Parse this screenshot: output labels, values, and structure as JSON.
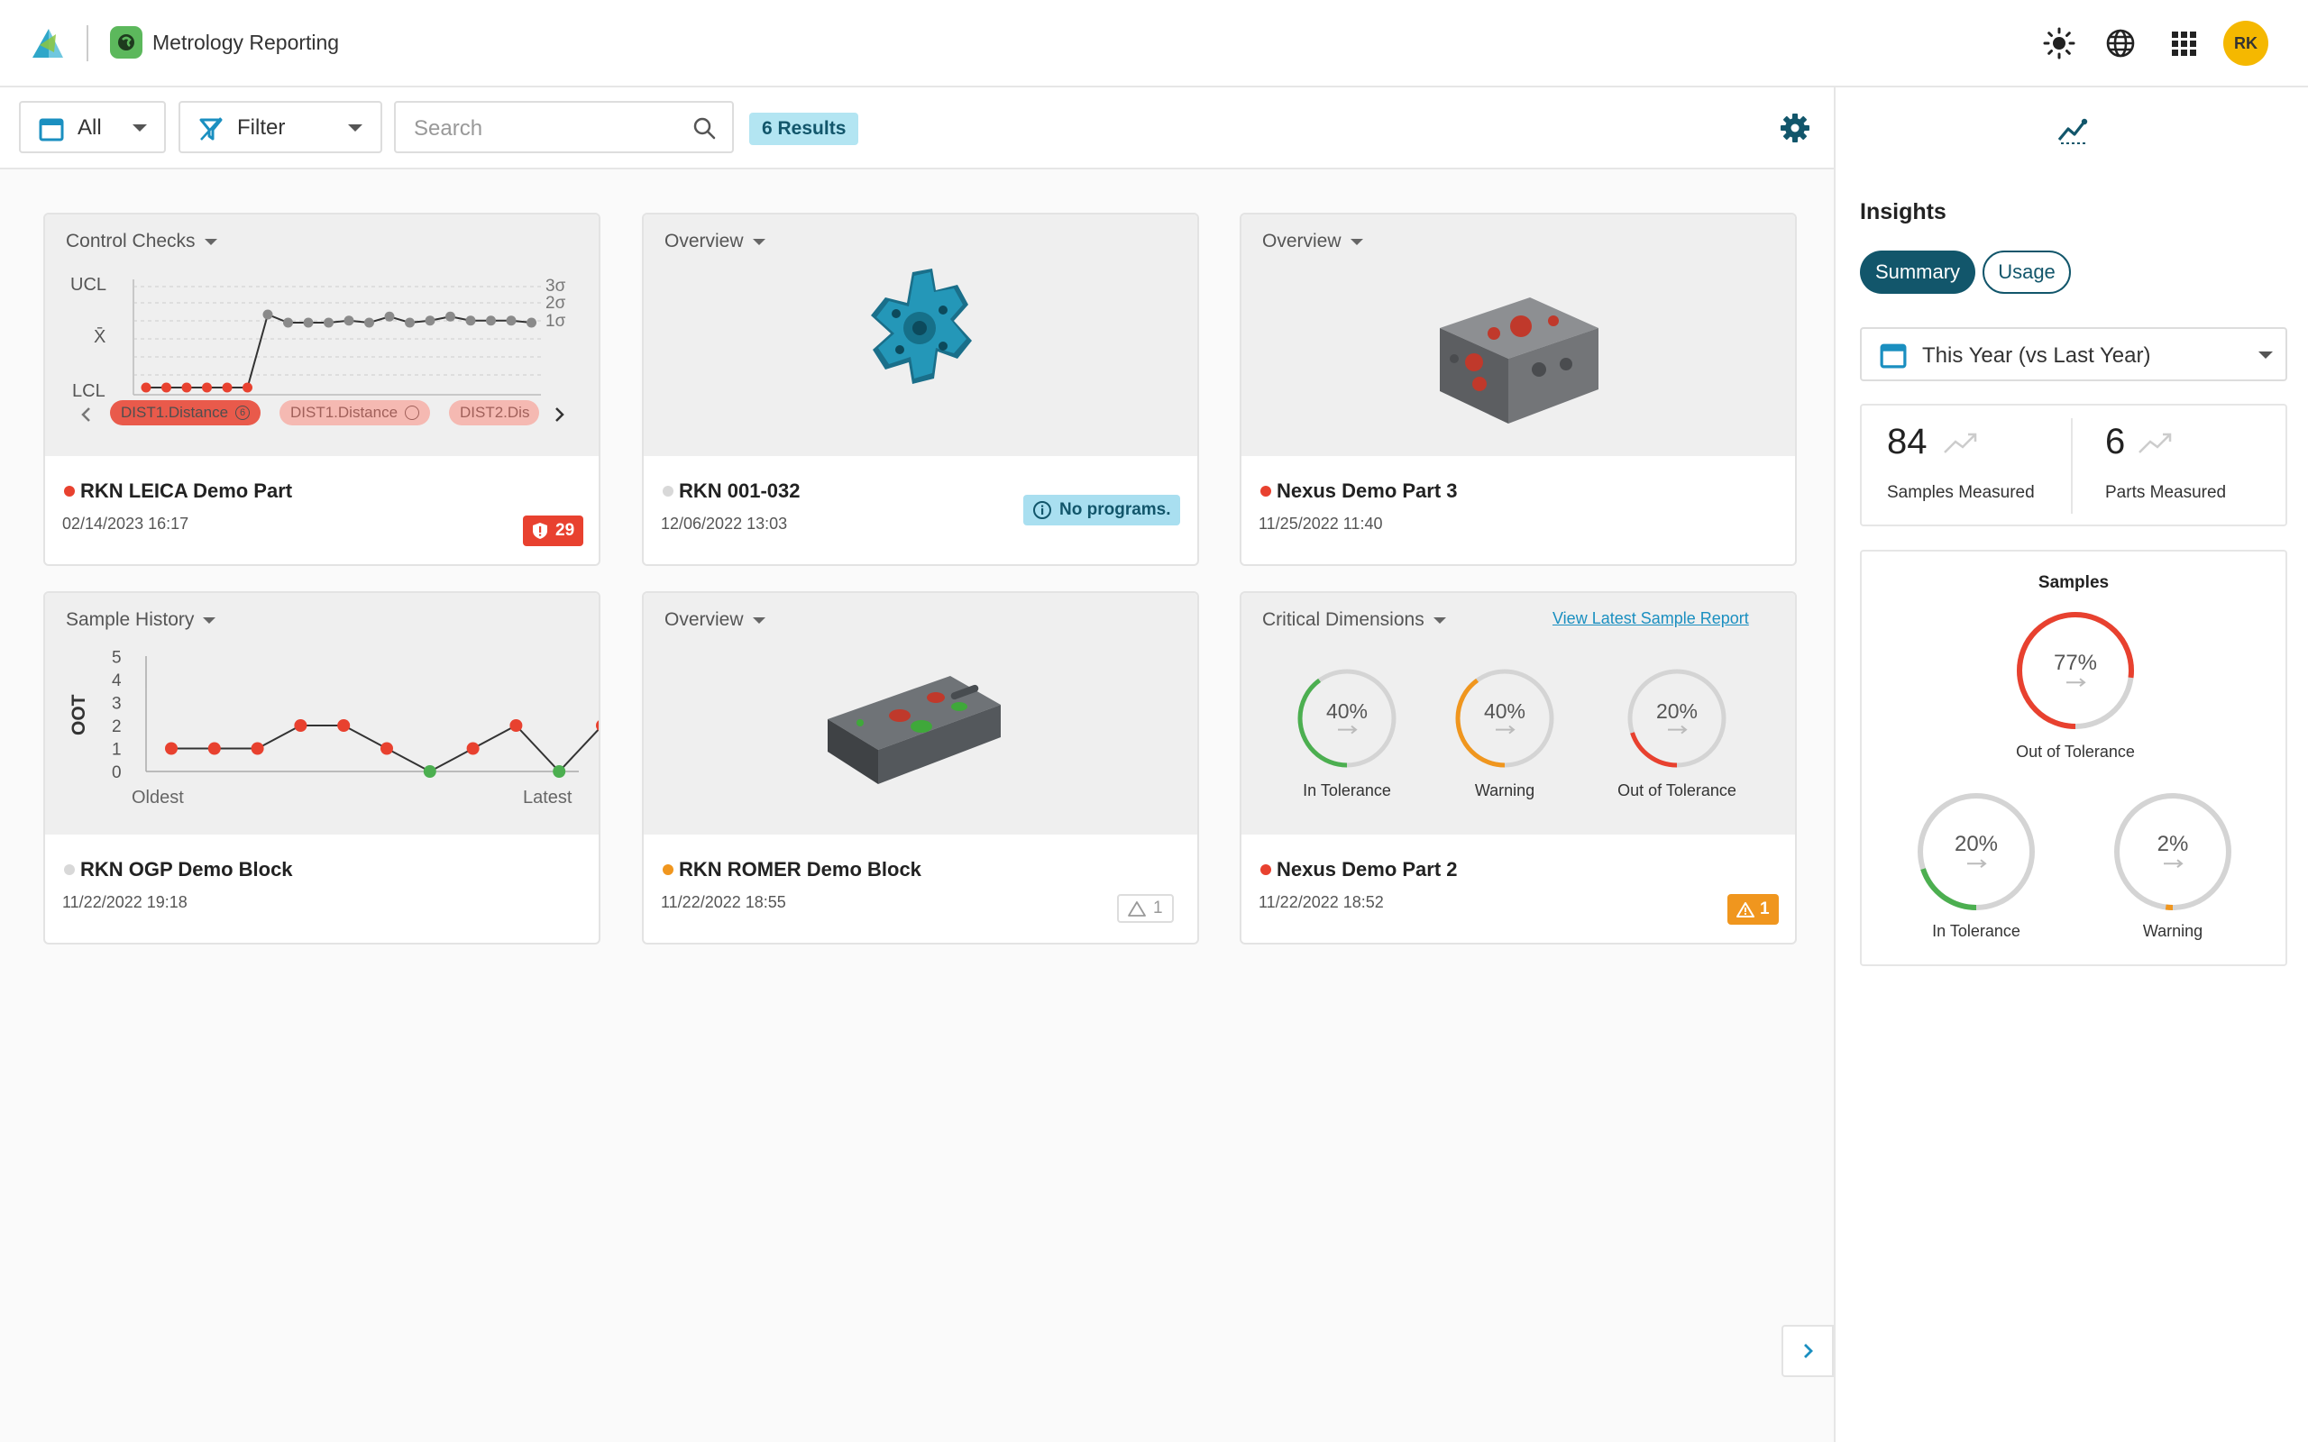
{
  "app": {
    "title": "Metrology Reporting",
    "user_initials": "RK",
    "icons": [
      "logo-icon",
      "app-icon",
      "theme-sun-icon",
      "globe-icon",
      "apps-grid-icon"
    ]
  },
  "toolbar": {
    "date_filter": "All",
    "filter_label": "Filter",
    "search_placeholder": "Search",
    "results": "6 Results"
  },
  "cards": [
    {
      "widget": "Control Checks",
      "title": "RKN LEICA Demo Part",
      "date": "02/14/2023 16:17",
      "status_color": "#e8412f",
      "badge": "29",
      "chart": {
        "y_labels": [
          "UCL",
          "X̄",
          "LCL"
        ],
        "sigma_labels": [
          "3σ",
          "2σ",
          "1σ"
        ],
        "chips": [
          "DIST1.Distance",
          "DIST1.Distance",
          "DIST2.Dis"
        ]
      }
    },
    {
      "widget": "Overview",
      "title": "RKN 001-032",
      "date": "12/06/2022 13:03",
      "status_color": "#d8d8d8",
      "badge": "No programs."
    },
    {
      "widget": "Overview",
      "title": "Nexus Demo Part 3",
      "date": "11/25/2022 11:40",
      "status_color": "#e8412f"
    },
    {
      "widget": "Sample History",
      "title": "RKN OGP Demo Block",
      "date": "11/22/2022 19:18",
      "status_color": "#d8d8d8",
      "chart": {
        "ylabel": "OOT",
        "y_ticks": [
          "5",
          "4",
          "3",
          "2",
          "1",
          "0"
        ],
        "x_start": "Oldest",
        "x_end": "Latest"
      }
    },
    {
      "widget": "Overview",
      "title": "RKN ROMER Demo Block",
      "date": "11/22/2022 18:55",
      "status_color": "#f0961e",
      "badge": "1"
    },
    {
      "widget": "Critical Dimensions",
      "link": "View Latest Sample Report",
      "title": "Nexus Demo Part 2",
      "date": "11/22/2022 18:52",
      "status_color": "#e8412f",
      "badge": "1",
      "gauges": [
        {
          "value": "40%",
          "label": "In Tolerance",
          "color": "#4caf50",
          "fraction": 0.4
        },
        {
          "value": "40%",
          "label": "Warning",
          "color": "#f0961e",
          "fraction": 0.4
        },
        {
          "value": "20%",
          "label": "Out of Tolerance",
          "color": "#e8412f",
          "fraction": 0.2
        }
      ]
    }
  ],
  "sample_history": {
    "values": [
      1,
      1,
      1,
      2,
      2,
      1,
      0,
      1,
      2,
      0,
      2
    ]
  },
  "control_checks": {
    "values": [
      -1.2,
      -1.2,
      -1.2,
      -1.2,
      -1.2,
      -1.2,
      0.6,
      0.4,
      0.4,
      0.4,
      0.45,
      0.4,
      0.55,
      0.4,
      0.45,
      0.55,
      0.45,
      0.45,
      0.45,
      0.4
    ],
    "out_of_control_count": 6
  },
  "insights": {
    "title": "Insights",
    "tabs": [
      "Summary",
      "Usage"
    ],
    "period": "This Year (vs Last Year)",
    "stats": [
      {
        "value": "84",
        "label": "Samples Measured"
      },
      {
        "value": "6",
        "label": "Parts Measured"
      }
    ],
    "samples_title": "Samples",
    "samples": [
      {
        "value": "77%",
        "label": "Out of Tolerance",
        "color": "#e8412f",
        "fraction": 0.77
      },
      {
        "value": "20%",
        "label": "In Tolerance",
        "color": "#4caf50",
        "fraction": 0.2
      },
      {
        "value": "2%",
        "label": "Warning",
        "color": "#f0961e",
        "fraction": 0.02
      }
    ]
  }
}
